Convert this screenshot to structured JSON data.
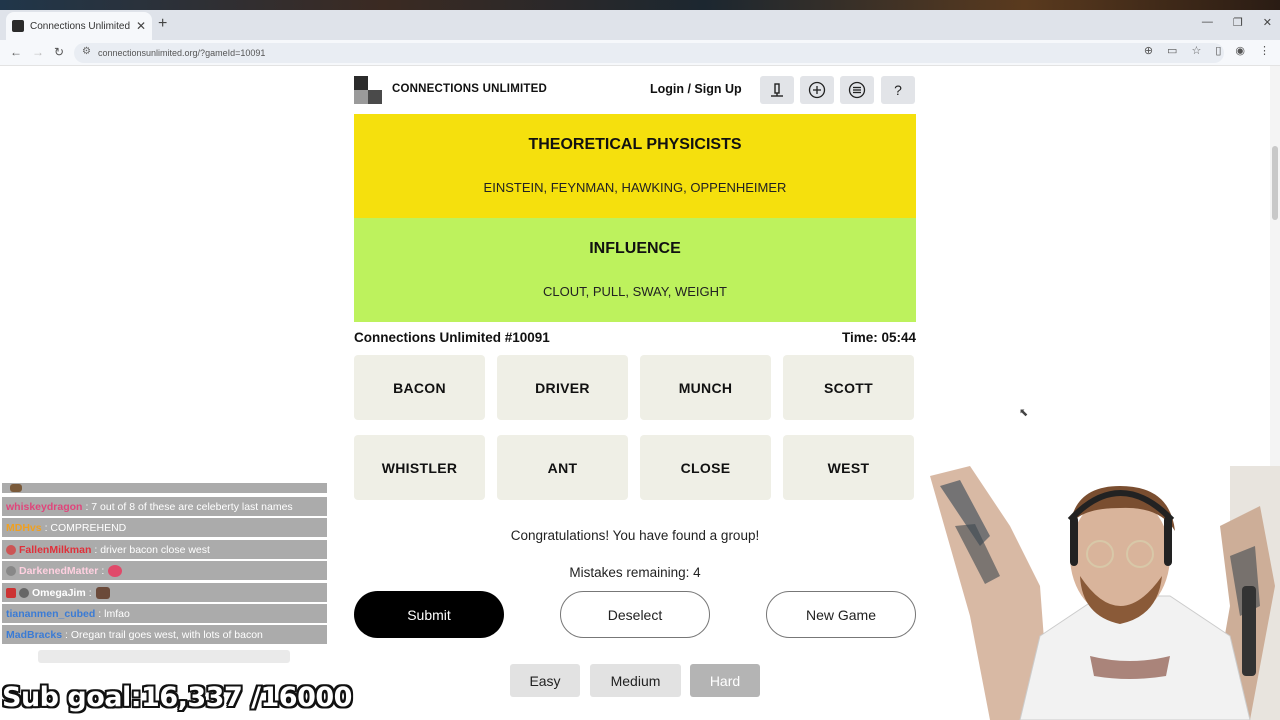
{
  "browser": {
    "tab_title": "Connections Unlimited NYT Ga",
    "tab_close": "✕",
    "new_tab": "+",
    "url": "connectionsunlimited.org/?gameId=10091",
    "window_controls": [
      "—",
      "❐",
      "✕"
    ]
  },
  "header": {
    "brand": "CONNECTIONS UNLIMITED",
    "login": "Login / Sign Up",
    "icons": [
      "podium-icon",
      "add-circle-icon",
      "menu-circle-icon",
      "help-icon"
    ],
    "help_label": "?"
  },
  "groups": [
    {
      "title": "THEORETICAL PHYSICISTS",
      "members": "EINSTEIN, FEYNMAN, HAWKING, OPPENHEIMER",
      "color": "#f5e00d"
    },
    {
      "title": "INFLUENCE",
      "members": "CLOUT, PULL, SWAY, WEIGHT",
      "color": "#bdf25d"
    }
  ],
  "game": {
    "puzzle_id": "Connections Unlimited #10091",
    "timer": "Time: 05:44",
    "tiles": [
      "BACON",
      "DRIVER",
      "MUNCH",
      "SCOTT",
      "WHISTLER",
      "ANT",
      "CLOSE",
      "WEST"
    ],
    "message": "Congratulations! You have found a group!",
    "mistakes": "Mistakes remaining: 4",
    "buttons": {
      "submit": "Submit",
      "deselect": "Deselect",
      "new_game": "New Game"
    },
    "difficulties": [
      "Easy",
      "Medium",
      "Hard"
    ],
    "selected_difficulty": "Hard"
  },
  "chat": [
    {
      "user": "",
      "text": "",
      "user_color": "#ffffff"
    },
    {
      "user": "whiskeydragon",
      "text": ": 7 out of 8 of these are celeberty last names",
      "user_color": "#e0457b"
    },
    {
      "user": "MDHvs",
      "text": ": COMPREHEND",
      "user_color": "#f0a020"
    },
    {
      "user": "FallenMilkman",
      "text": ": driver bacon close west",
      "user_color": "#e0303a"
    },
    {
      "user": "DarkenedMatter",
      "text": ":",
      "user_color": "#ffd0e0"
    },
    {
      "user": "OmegaJim",
      "text": ":",
      "user_color": "#ffffff"
    },
    {
      "user": "tiananmen_cubed",
      "text": ": lmfao",
      "user_color": "#3a7bd5"
    },
    {
      "user": "MadBracks",
      "text": ": Oregan trail goes west, with lots of bacon",
      "user_color": "#3a7bd5"
    }
  ],
  "overlay": {
    "sub_goal": "Sub goal:16,337 /16000"
  }
}
